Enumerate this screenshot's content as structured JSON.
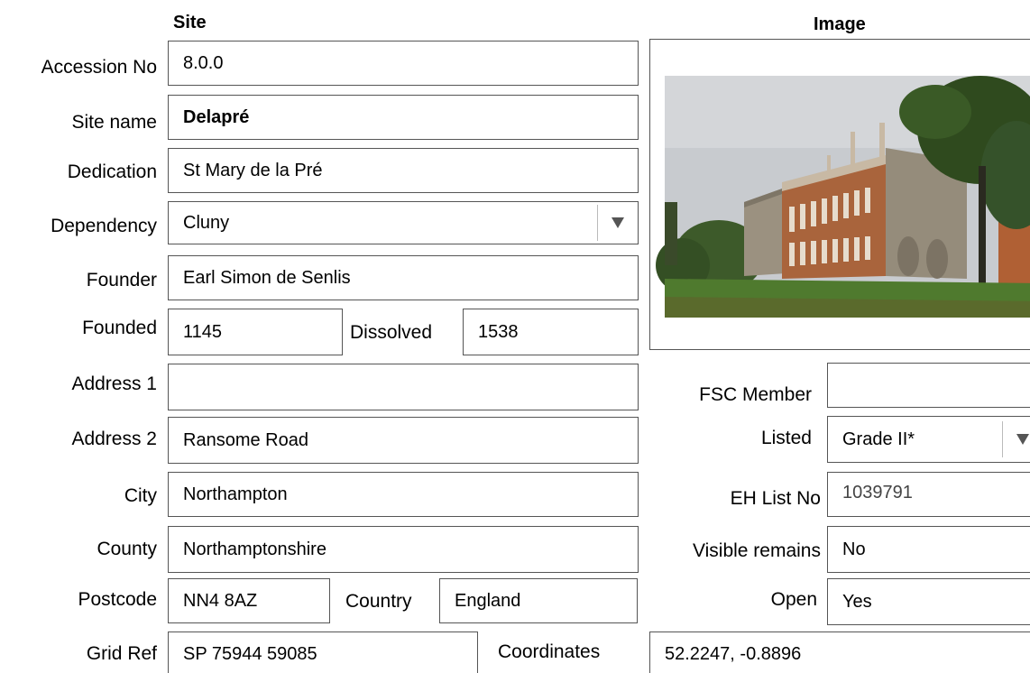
{
  "headers": {
    "site": "Site",
    "image": "Image"
  },
  "fields": {
    "accession_no": {
      "label": "Accession No",
      "value": "8.0.0"
    },
    "site_name": {
      "label": "Site name",
      "value": "Delapré"
    },
    "dedication": {
      "label": "Dedication",
      "value": "St Mary de la Pré"
    },
    "dependency": {
      "label": "Dependency",
      "value": "Cluny",
      "icon": "dropdown-arrow-icon"
    },
    "founder": {
      "label": "Founder",
      "value": "Earl Simon de Senlis"
    },
    "founded": {
      "label": "Founded",
      "value": "1145"
    },
    "dissolved": {
      "label": "Dissolved",
      "value": "1538"
    },
    "address1": {
      "label": "Address 1",
      "value": ""
    },
    "address2": {
      "label": "Address 2",
      "value": "Ransome Road"
    },
    "city": {
      "label": "City",
      "value": "Northampton"
    },
    "county": {
      "label": "County",
      "value": "Northamptonshire"
    },
    "postcode": {
      "label": "Postcode",
      "value": "NN4 8AZ"
    },
    "country": {
      "label": "Country",
      "value": "England"
    },
    "grid_ref": {
      "label": "Grid Ref",
      "value": "SP 75944 59085"
    },
    "coordinates": {
      "label": "Coordinates",
      "value": "52.2247, -0.8896"
    },
    "fsc_member": {
      "label": "FSC Member",
      "value": ""
    },
    "listed": {
      "label": "Listed",
      "value": "Grade II*",
      "icon": "dropdown-arrow-icon"
    },
    "eh_list_no": {
      "label": "EH List No",
      "value": "1039791"
    },
    "visible_remains": {
      "label": "Visible remains",
      "value": "No"
    },
    "open": {
      "label": "Open",
      "value": "Yes"
    }
  },
  "colors": {
    "border": "#555555",
    "sky": "#c9ccd0",
    "grass": "#4f7a2e",
    "brick": "#b0643a",
    "stone": "#9c9484",
    "foliage": "#2f4a1e"
  }
}
